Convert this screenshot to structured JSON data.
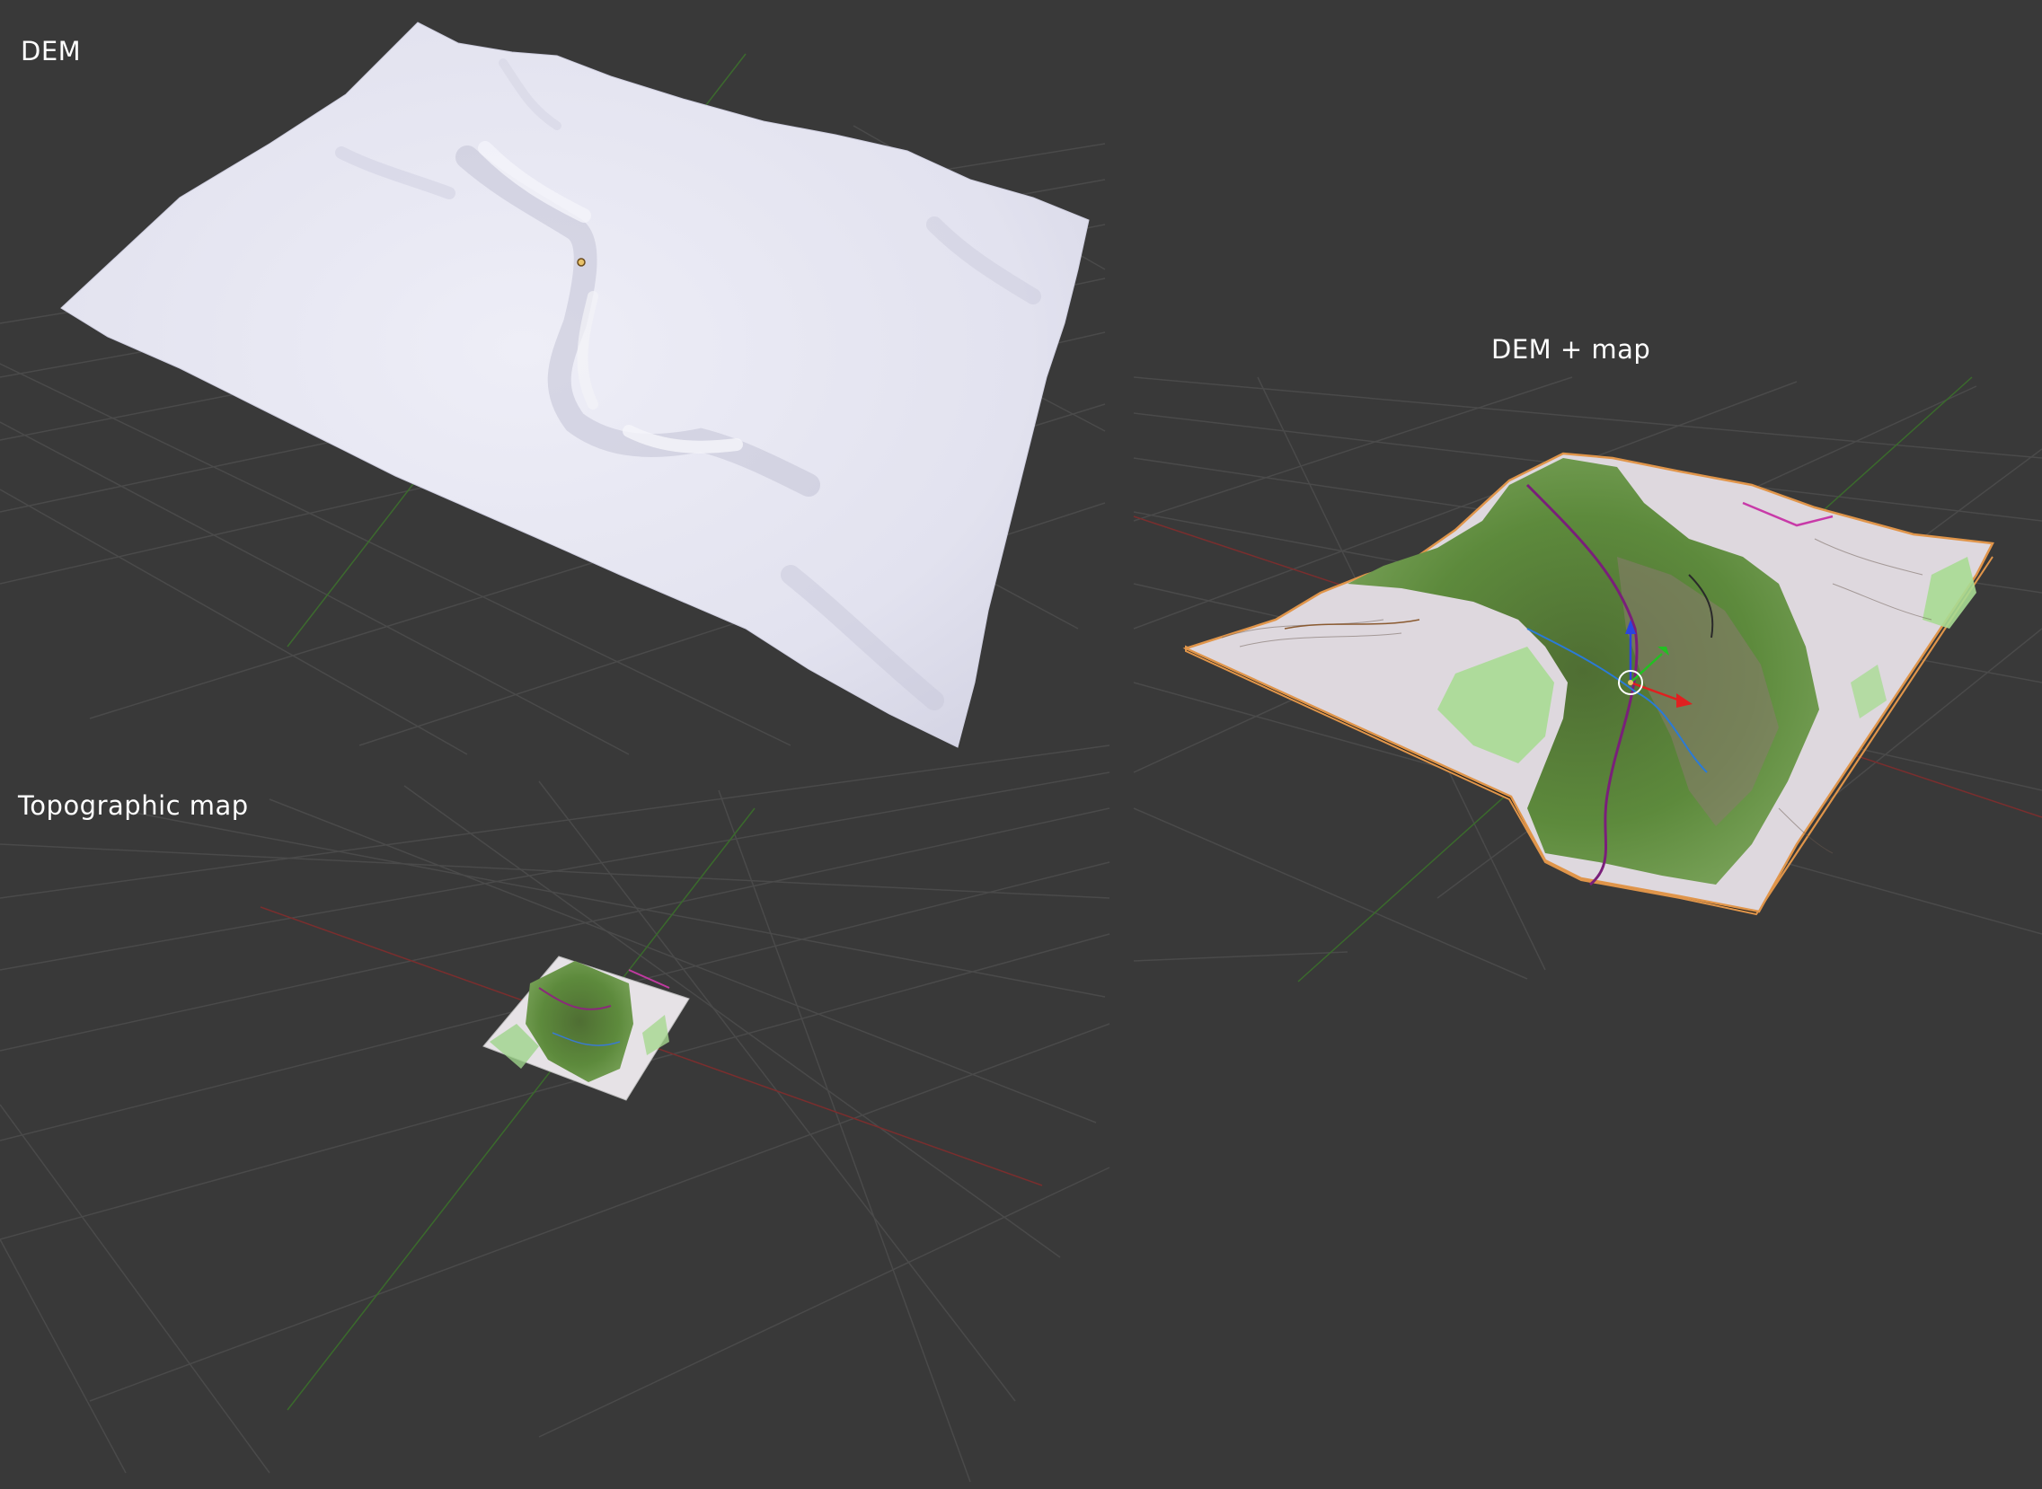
{
  "viewports": {
    "dem": {
      "label": "DEM"
    },
    "topographic_map": {
      "label": "Topographic map"
    },
    "dem_map": {
      "label": "DEM + map"
    }
  },
  "colors": {
    "background": "#393939",
    "grid": "#4d4d4d",
    "axis_x": "#8a3030",
    "axis_y": "#3c7a2e",
    "dem_surface": "#e4e4f0",
    "selection_outline": "#e0954a",
    "gizmo_x": "#e02020",
    "gizmo_y": "#20c020",
    "gizmo_z": "#2040e0"
  },
  "icons": [
    "origin-dot-icon",
    "transform-gizmo-icon"
  ]
}
